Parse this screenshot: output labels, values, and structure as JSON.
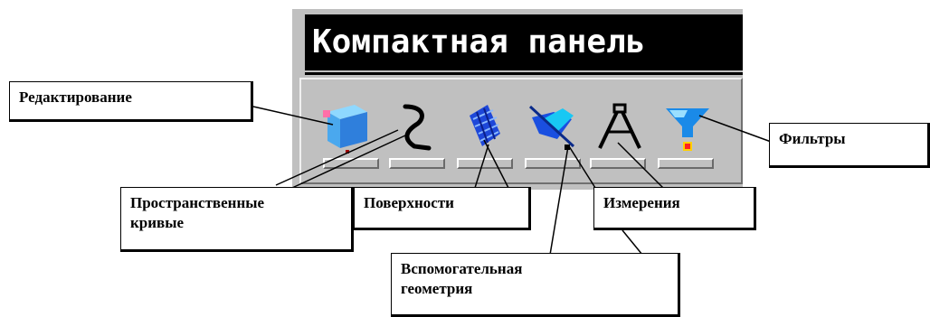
{
  "panel": {
    "title": "Компактная панель"
  },
  "tools": [
    {
      "icon": "cube-edit-icon",
      "label": "Редактирование"
    },
    {
      "icon": "spatial-curve-icon",
      "label": "Пространственные кривые"
    },
    {
      "icon": "surface-icon",
      "label": "Поверхности"
    },
    {
      "icon": "auxiliary-geometry-icon",
      "label": "Вспомогательная геометрия"
    },
    {
      "icon": "compass-measure-icon",
      "label": "Измерения"
    },
    {
      "icon": "funnel-filter-icon",
      "label": "Фильтры"
    }
  ],
  "callouts": {
    "editing": "Редактирование",
    "spatial_curves_line1": "Пространственные",
    "spatial_curves_line2": "кривые",
    "surfaces": "Поверхности",
    "aux_geometry_line1": "Вспомогательная",
    "aux_geometry_line2": "геометрия",
    "measurements": "Измерения",
    "filters": "Фильтры"
  }
}
